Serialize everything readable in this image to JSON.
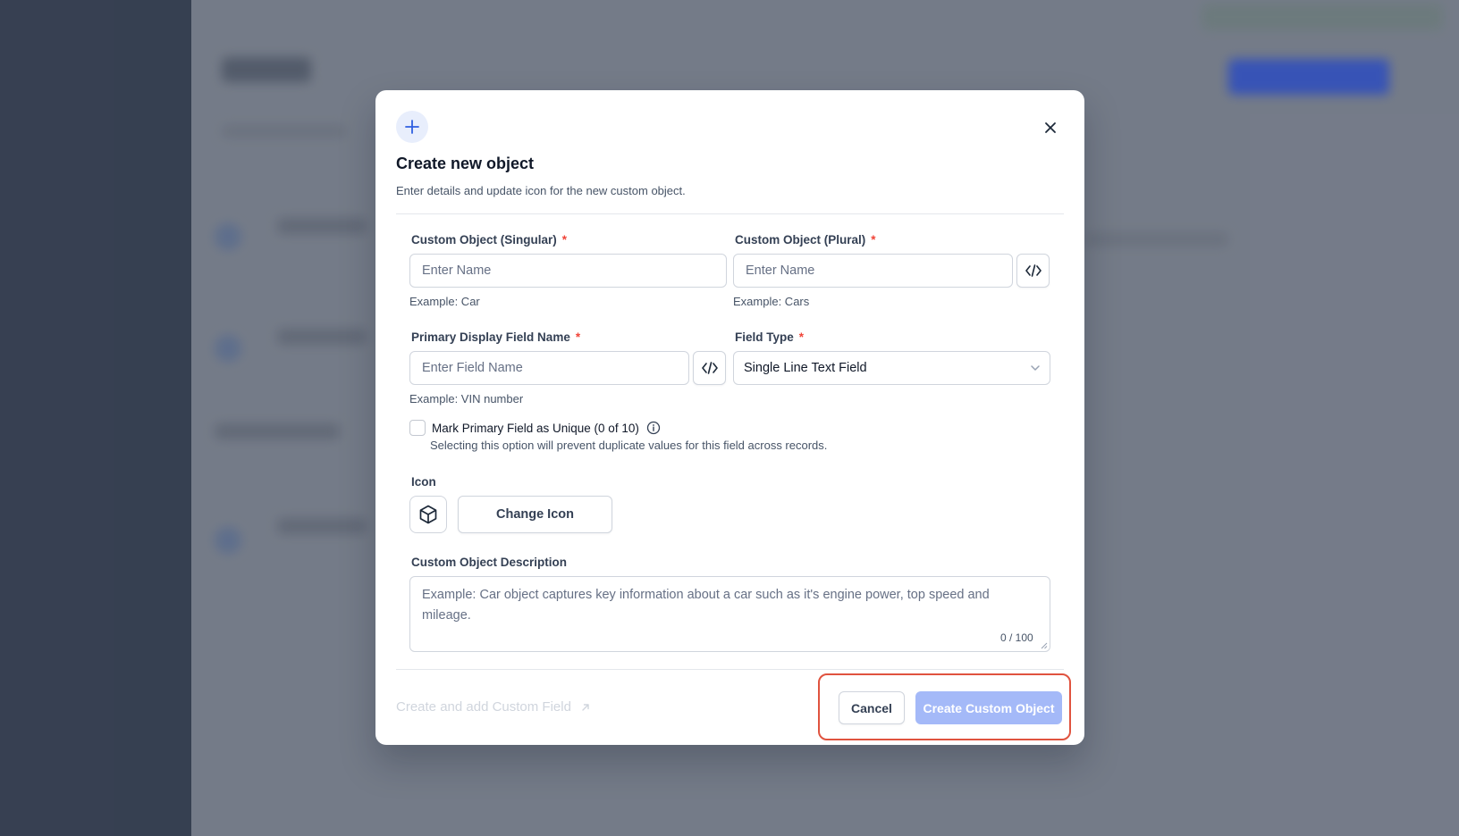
{
  "modal": {
    "title": "Create new object",
    "subtitle": "Enter details and update icon for the new custom object.",
    "singular": {
      "label": "Custom Object (Singular)",
      "required_mark": "*",
      "placeholder": "Enter Name",
      "value": "",
      "hint": "Example: Car"
    },
    "plural": {
      "label": "Custom Object (Plural)",
      "required_mark": "*",
      "placeholder": "Enter Name",
      "value": "",
      "hint": "Example: Cars"
    },
    "primary_field": {
      "label": "Primary Display Field Name",
      "required_mark": "*",
      "placeholder": "Enter Field Name",
      "value": "",
      "hint": "Example: VIN number"
    },
    "field_type": {
      "label": "Field Type",
      "required_mark": "*",
      "selected": "Single Line Text Field"
    },
    "unique": {
      "label": "Mark Primary Field as Unique (0 of 10)",
      "description": "Selecting this option will prevent duplicate values for this field across records.",
      "checked": false
    },
    "icon_section": {
      "label": "Icon",
      "current_icon": "cube-icon",
      "change_button": "Change Icon"
    },
    "description": {
      "label": "Custom Object Description",
      "placeholder": "Example: Car object captures key information about a car such as it's engine power, top speed and mileage.",
      "counter": "0 / 100"
    },
    "footer": {
      "link_label": "Create and add Custom Field",
      "cancel_label": "Cancel",
      "create_label": "Create Custom Object"
    }
  },
  "colors": {
    "primary_disabled": "#a4b9f8",
    "required": "#f04438",
    "highlight": "#e0533f",
    "plus_badge_bg": "#e8eefc",
    "plus_icon": "#2f5fe0"
  }
}
